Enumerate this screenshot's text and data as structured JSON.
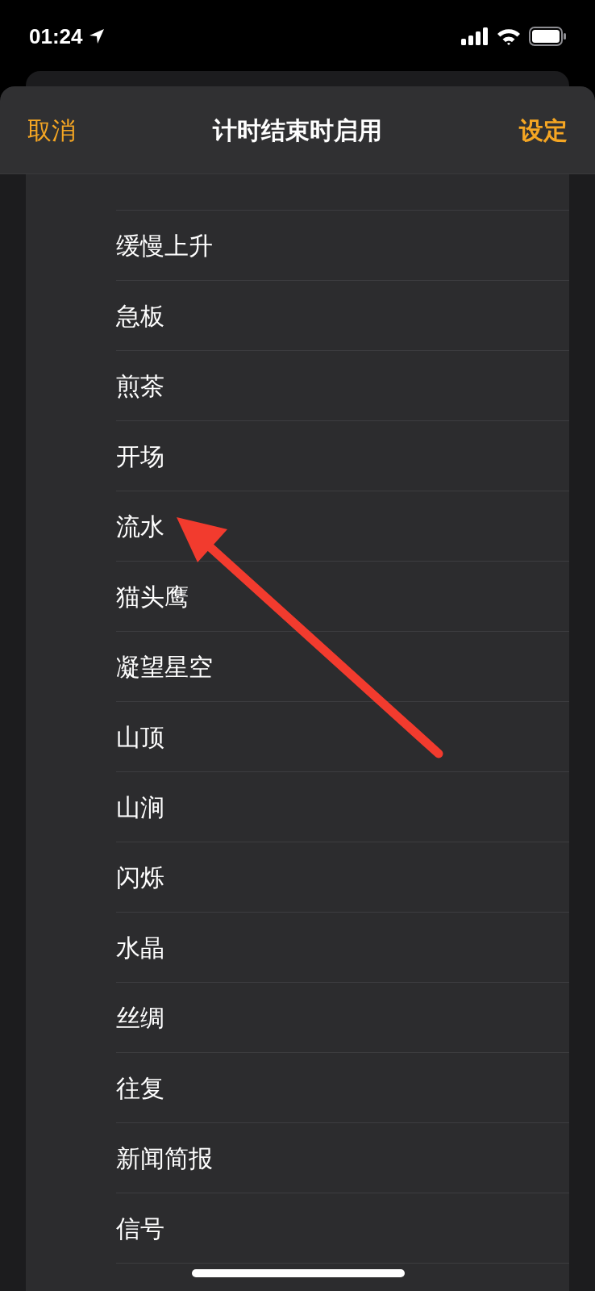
{
  "status_bar": {
    "time": "01:24"
  },
  "header": {
    "cancel": "取消",
    "title": "计时结束时启用",
    "confirm": "设定"
  },
  "items": [
    "缓慢上升",
    "急板",
    "煎茶",
    "开场",
    "流水",
    "猫头鹰",
    "凝望星空",
    "山顶",
    "山涧",
    "闪烁",
    "水晶",
    "丝绸",
    "往复",
    "新闻简报",
    "信号"
  ]
}
